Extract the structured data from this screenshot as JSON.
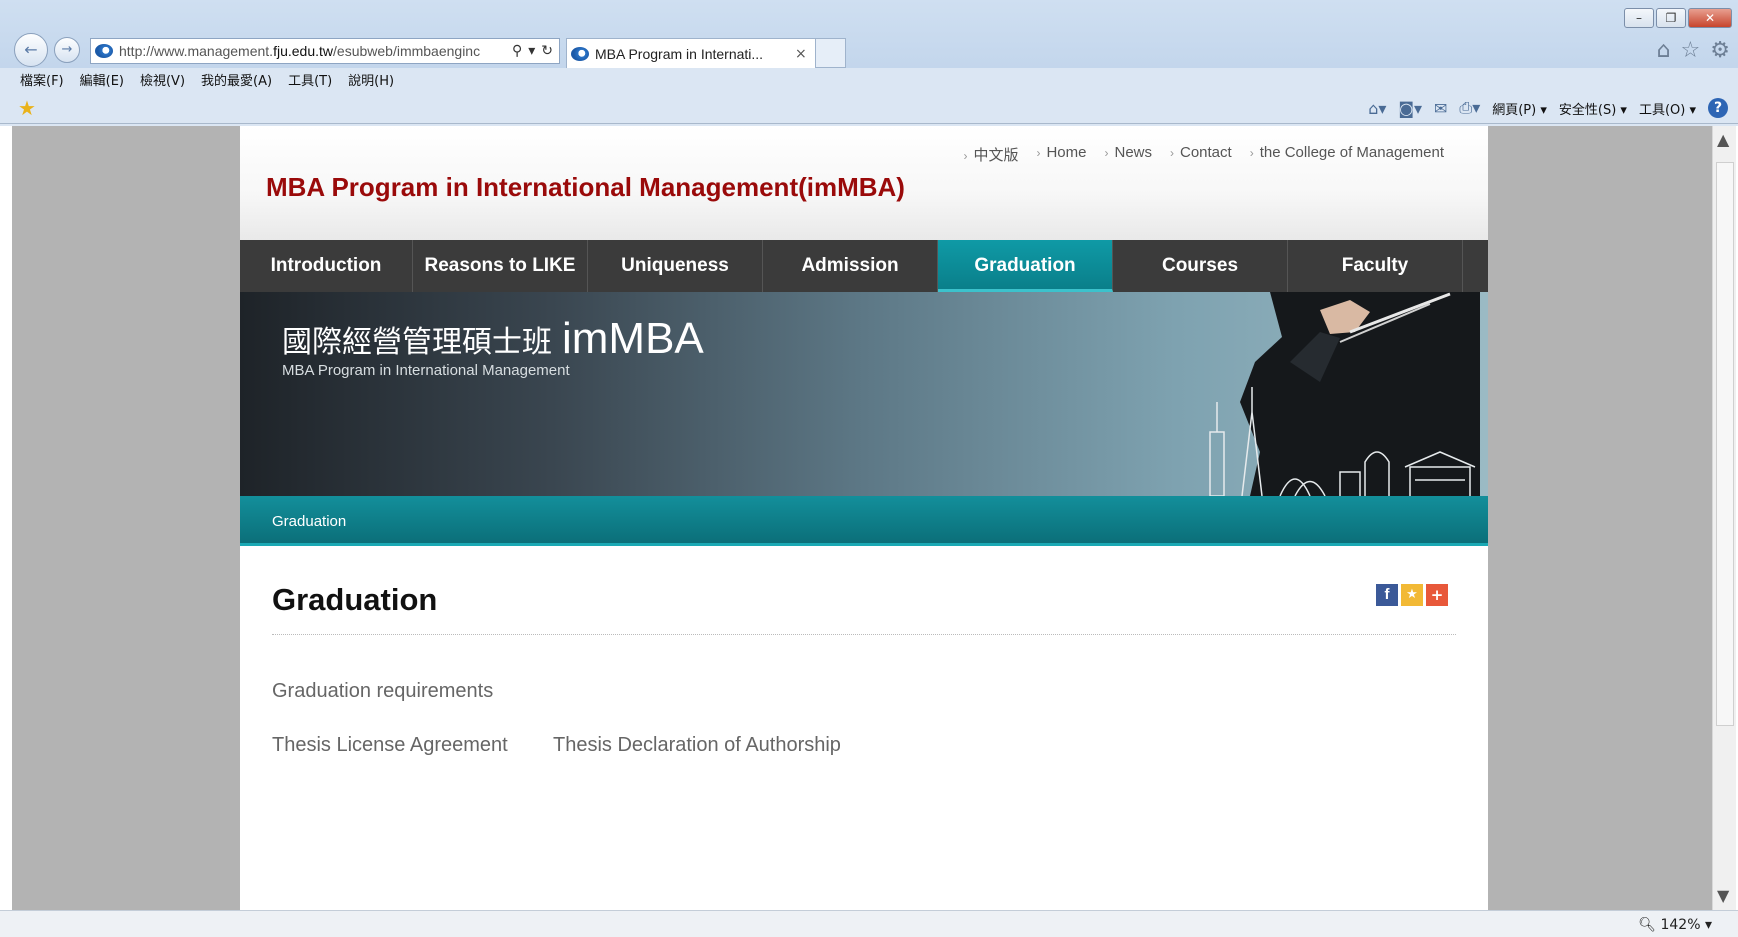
{
  "browser": {
    "url_prefix": "http://www.management.",
    "url_domain": "fju.edu.tw",
    "url_suffix": "/esubweb/immbaenginc",
    "tab_title": "MBA Program in Internati...",
    "tab_close": "×",
    "menu": [
      "檔案(F)",
      "編輯(E)",
      "檢視(V)",
      "我的最愛(A)",
      "工具(T)",
      "說明(H)"
    ],
    "commands": {
      "page": "網頁(P) ▾",
      "safety": "安全性(S) ▾",
      "tools": "工具(O) ▾"
    },
    "zoom": "142%",
    "icons": [
      "back-icon",
      "forward-icon",
      "search-icon",
      "refresh-icon",
      "home-icon",
      "favorites-star-icon",
      "settings-gear-icon",
      "rss-icon",
      "mail-icon",
      "print-icon",
      "help-icon"
    ]
  },
  "site": {
    "title": "MBA Program in International Management(imMBA)",
    "toplinks": [
      "中文版",
      "Home",
      "News",
      "Contact",
      "the College of Management"
    ],
    "nav": [
      "Introduction",
      "Reasons to LIKE",
      "Uniqueness",
      "Admission",
      "Graduation",
      "Courses",
      "Faculty"
    ],
    "active_nav": "Graduation",
    "banner": {
      "cn_title": "國際經營管理碩士班",
      "en_title": "imMBA",
      "subtitle": "MBA Program in International Management"
    },
    "breadcrumb": "Graduation"
  },
  "content": {
    "title": "Graduation",
    "links": {
      "requirements": "Graduation requirements",
      "license": "Thesis License Agreement",
      "declaration": "Thesis Declaration of Authorship"
    },
    "share": {
      "facebook": "f",
      "bookmark": "★",
      "plus": "+"
    }
  },
  "colors": {
    "title_red": "#9a0a0a",
    "nav_dark": "#3b3b3b",
    "teal": "#0b7f8a"
  }
}
